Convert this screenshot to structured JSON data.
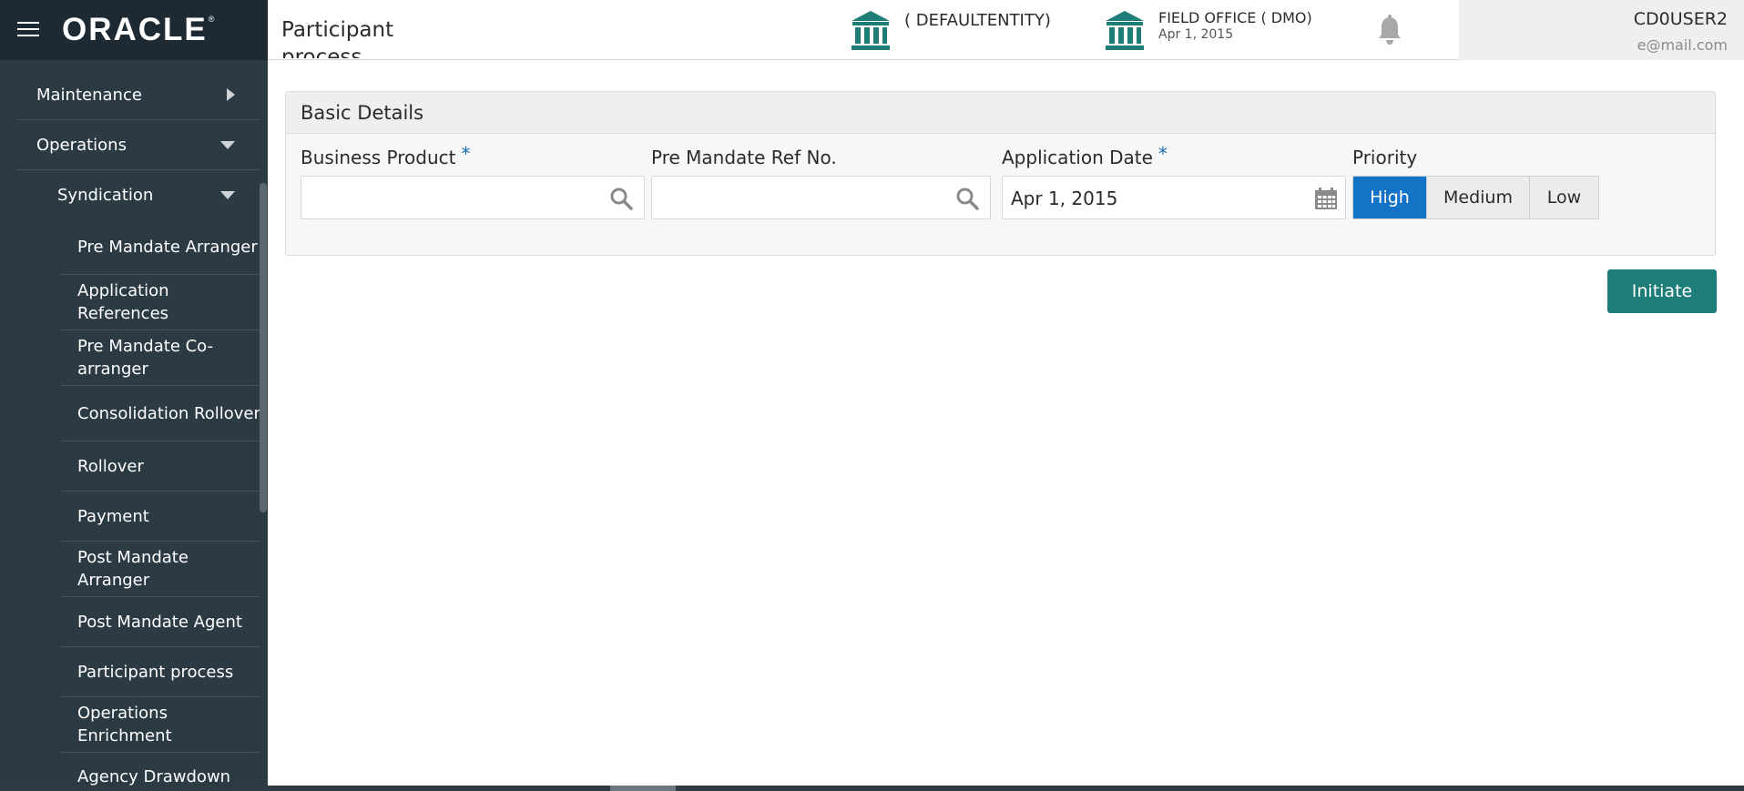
{
  "header": {
    "logo": "ORACLE",
    "logo_mark": "®",
    "page_title": "Participant process",
    "entity1": {
      "name": "( DEFAULTENTITY)"
    },
    "entity2": {
      "name": "FIELD OFFICE  ( DMO)",
      "date": "Apr 1, 2015"
    },
    "user": {
      "name": "CD0USER2",
      "email": "e@mail.com"
    },
    "icons": {
      "menu": "hamburger-icon",
      "bank": "bank-icon",
      "bell": "bell-icon"
    }
  },
  "sidebar": {
    "maintenance": "Maintenance",
    "operations": "Operations",
    "syndication": "Syndication",
    "items": [
      "Pre Mandate Arranger",
      "Application References",
      "Pre Mandate Co-arranger",
      "Consolidation Rollover",
      "Rollover",
      "Payment",
      "Post Mandate Arranger",
      "Post Mandate Agent",
      "Participant process",
      "Operations Enrichment",
      "Agency Drawdown"
    ]
  },
  "basic_details": {
    "title": "Basic Details",
    "business_product": {
      "label": "Business Product",
      "required": "*",
      "value": ""
    },
    "pre_mandate_ref": {
      "label": "Pre Mandate Ref No.",
      "value": ""
    },
    "application_date": {
      "label": "Application Date",
      "required": "*",
      "value": "Apr 1, 2015"
    },
    "priority": {
      "label": "Priority",
      "options": [
        "High",
        "Medium",
        "Low"
      ],
      "selected": "High"
    }
  },
  "actions": {
    "initiate": "Initiate"
  },
  "colors": {
    "accent": "#1473c7",
    "teal": "#1d7d79",
    "sidebar": "#2c3a43",
    "brand_bar": "#1e2a33",
    "bank_icon": "#1f7d78"
  }
}
